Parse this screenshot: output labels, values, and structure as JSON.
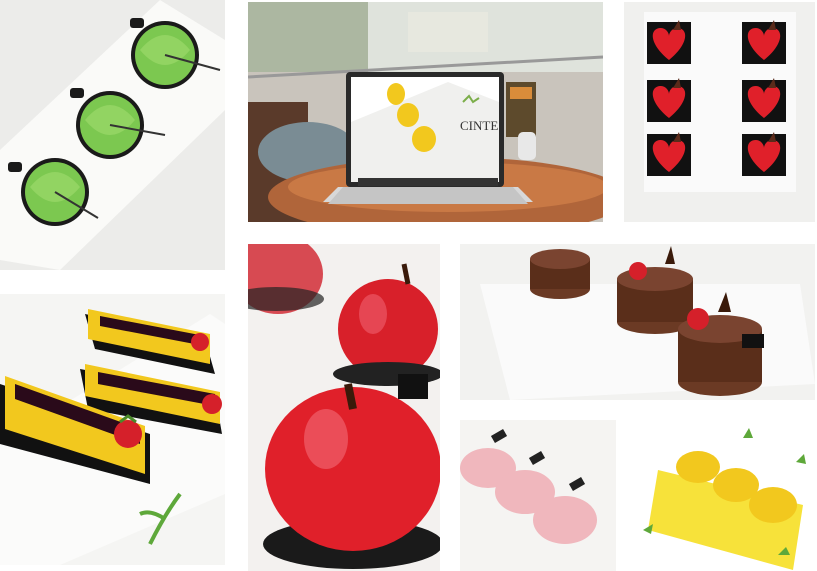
{
  "collage": {
    "tiles": [
      {
        "subject": "green-swirl-mousse"
      },
      {
        "subject": "laptop-cafe-display",
        "screen_text": "CINTE"
      },
      {
        "subject": "red-heart-cakes"
      },
      {
        "subject": "yellow-bar-cakes-strawberry"
      },
      {
        "subject": "red-apple-mousse"
      },
      {
        "subject": "chocolate-cylinder-cakes"
      },
      {
        "subject": "pink-dome-cakes"
      },
      {
        "subject": "yellow-lemon-cakes"
      }
    ]
  },
  "colors": {
    "green_mousse": "#7cc850",
    "red_glaze": "#e0202a",
    "yellow_glaze": "#f2c81e",
    "chocolate": "#6b3a24",
    "pink_dome": "#f0b7bd",
    "plate_white": "#f7f7f5"
  }
}
